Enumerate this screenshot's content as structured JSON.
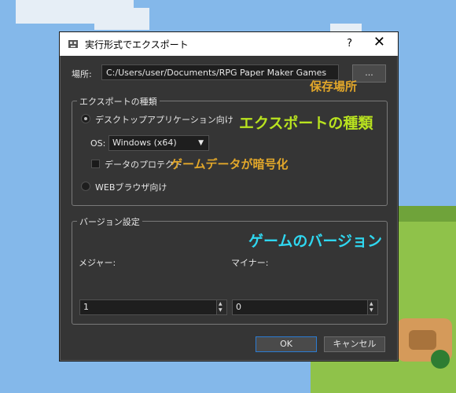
{
  "window": {
    "title": "実行形式でエクスポート",
    "help_label": "?",
    "close_label": "✕"
  },
  "location": {
    "label": "場所:",
    "path": "C:/Users/user/Documents/RPG Paper Maker Games",
    "browse_label": "..."
  },
  "annotations": {
    "save_location": "保存場所",
    "export_type": "エクスポートの種類",
    "encrypt": "ゲームデータが暗号化",
    "game_version": "ゲームのバージョン"
  },
  "export_group": {
    "title": "エクスポートの種類",
    "desktop_label": "デスクトップアプリケーション向け",
    "os_label": "OS:",
    "os_value": "Windows (x64)",
    "protect_label": "データのプロテクト",
    "web_label": "WEBブラウザ向け"
  },
  "version_group": {
    "title": "バージョン設定",
    "major_label": "メジャー:",
    "minor_label": "マイナー:",
    "major_value": "1",
    "minor_value": "0"
  },
  "buttons": {
    "ok": "OK",
    "cancel": "キャンセル"
  }
}
